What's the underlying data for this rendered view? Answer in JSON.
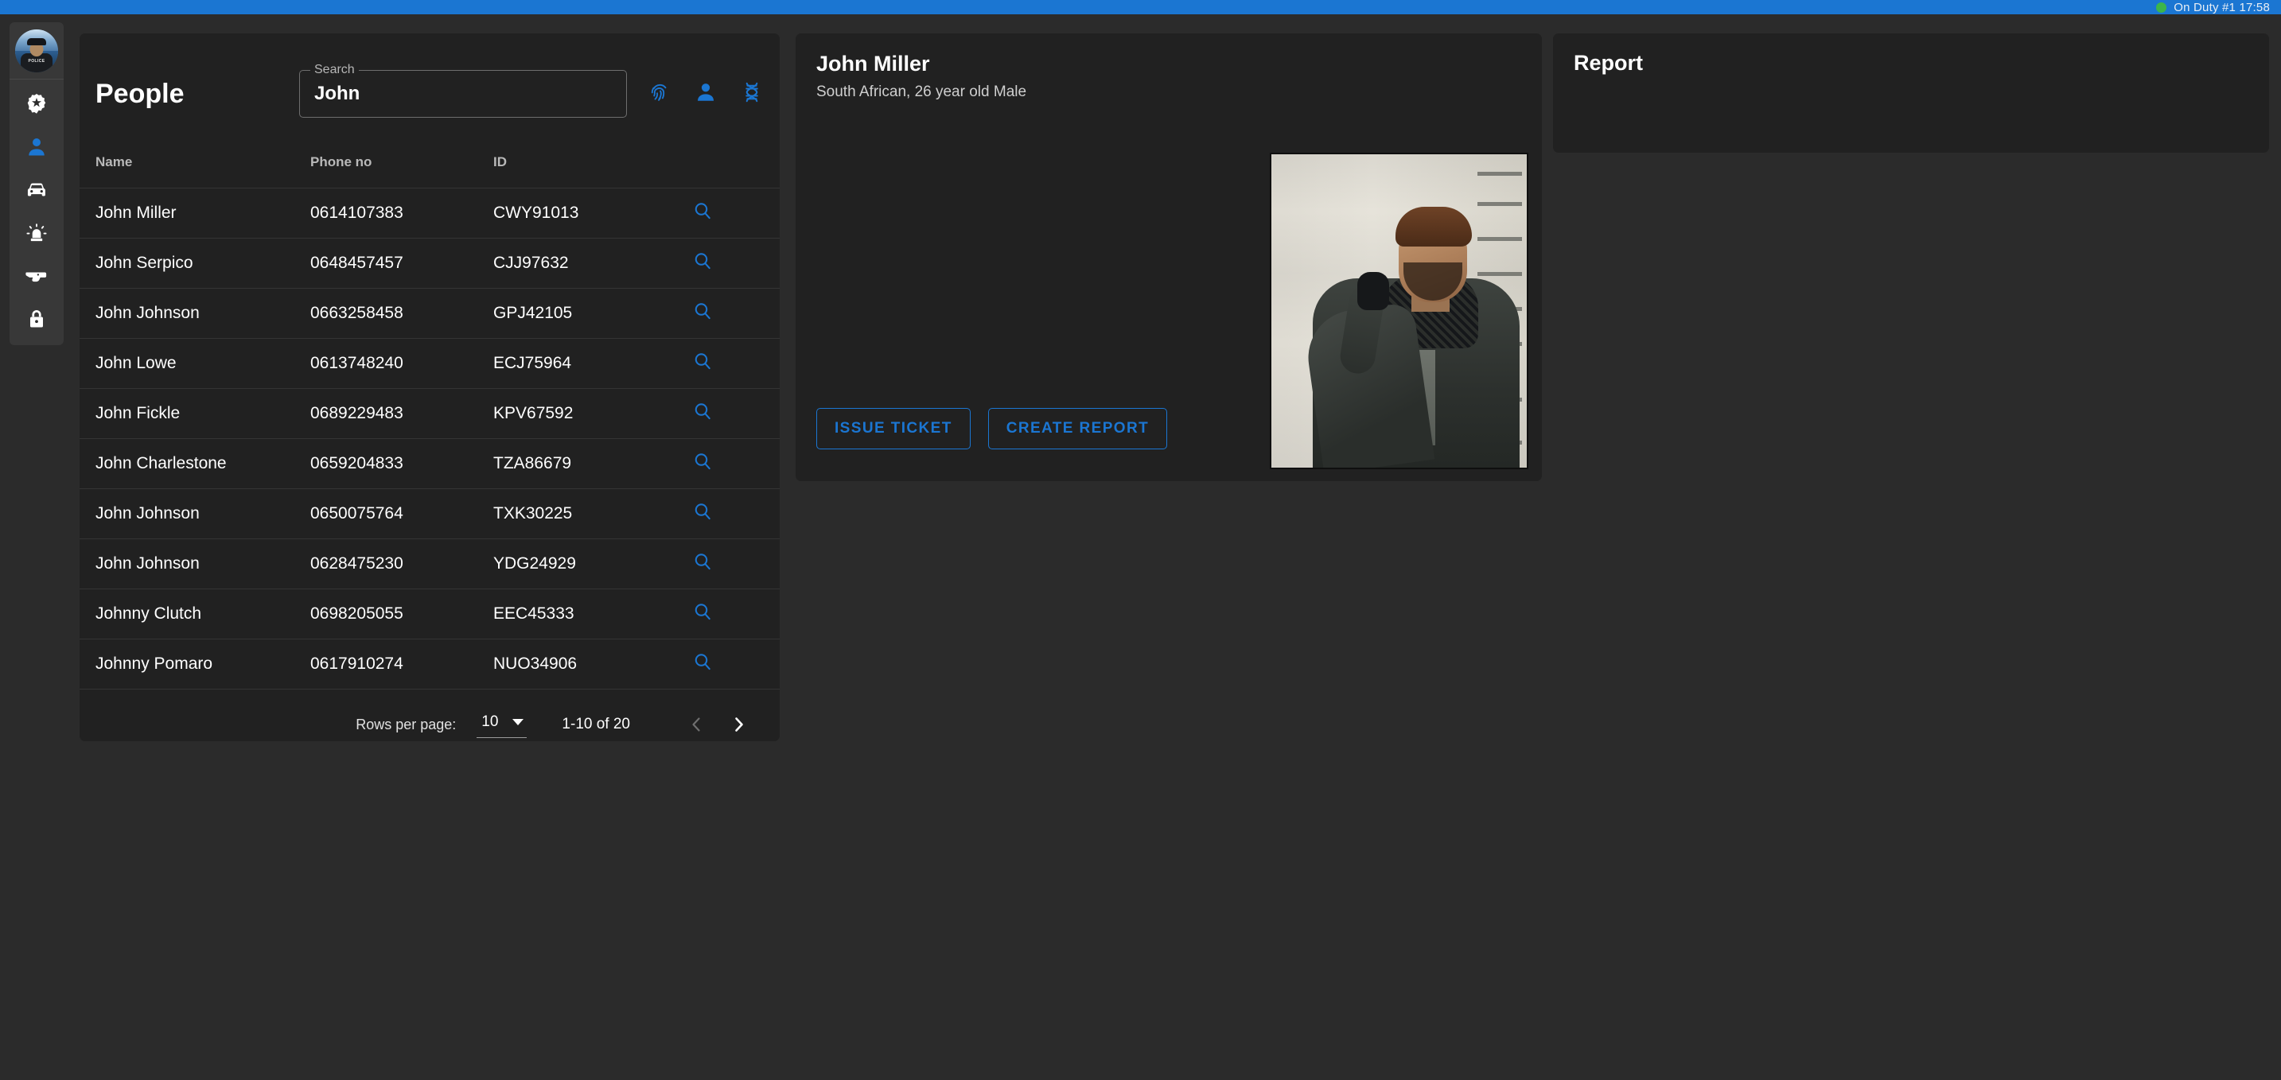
{
  "topbar": {
    "status_text": "On Duty #1 17:58",
    "dot_color": "#3cb54a",
    "bar_color": "#1b76d2"
  },
  "sidebar": {
    "avatar": {
      "name": "officer-avatar",
      "badge_text": "POLICE"
    },
    "items": [
      {
        "id": "sidebar-item-badge",
        "icon": "police-badge-icon",
        "active": false
      },
      {
        "id": "sidebar-item-people",
        "icon": "person-icon",
        "active": true
      },
      {
        "id": "sidebar-item-vehicles",
        "icon": "car-icon",
        "active": false
      },
      {
        "id": "sidebar-item-dispatch",
        "icon": "siren-icon",
        "active": false
      },
      {
        "id": "sidebar-item-weapons",
        "icon": "gun-icon",
        "active": false
      },
      {
        "id": "sidebar-item-logout",
        "icon": "lock-icon",
        "active": false
      }
    ]
  },
  "people": {
    "title": "People",
    "search": {
      "label": "Search",
      "value": "John",
      "placeholder": "Search"
    },
    "head_icons": [
      {
        "id": "fingerprint-search-icon",
        "name": "fingerprint-icon"
      },
      {
        "id": "person-search-icon",
        "name": "person-icon"
      },
      {
        "id": "dna-search-icon",
        "name": "dna-icon"
      }
    ],
    "columns": [
      "Name",
      "Phone no",
      "ID"
    ],
    "rows": [
      {
        "name": "John Miller",
        "phone": "0614107383",
        "id": "CWY91013"
      },
      {
        "name": "John Serpico",
        "phone": "0648457457",
        "id": "CJJ97632"
      },
      {
        "name": "John Johnson",
        "phone": "0663258458",
        "id": "GPJ42105"
      },
      {
        "name": "John Lowe",
        "phone": "0613748240",
        "id": "ECJ75964"
      },
      {
        "name": "John Fickle",
        "phone": "0689229483",
        "id": "KPV67592"
      },
      {
        "name": "John Charlestone",
        "phone": "0659204833",
        "id": "TZA86679"
      },
      {
        "name": "John Johnson",
        "phone": "0650075764",
        "id": "TXK30225"
      },
      {
        "name": "John Johnson",
        "phone": "0628475230",
        "id": "YDG24929"
      },
      {
        "name": "Johnny Clutch",
        "phone": "0698205055",
        "id": "EEC45333"
      },
      {
        "name": "Johnny Pomaro",
        "phone": "0617910274",
        "id": "NUO34906"
      }
    ],
    "paginator": {
      "rows_per_page_label": "Rows per page:",
      "rows_per_page_value": "10",
      "range_label": "1-10 of 20",
      "prev_enabled": false,
      "next_enabled": true
    }
  },
  "person_detail": {
    "name": "John Miller",
    "subtitle": "South African, 26 year old Male",
    "mugshot_alt": "john-miller-mugshot",
    "actions": [
      {
        "id": "issue-ticket-button",
        "label": "ISSUE TICKET"
      },
      {
        "id": "create-report-button",
        "label": "CREATE REPORT"
      }
    ]
  },
  "report": {
    "title": "Report"
  },
  "colors": {
    "accent": "#1b76d2",
    "card_bg": "#212121",
    "page_bg": "#2b2b2b",
    "rail_bg": "#383838",
    "divider": "#343434"
  }
}
